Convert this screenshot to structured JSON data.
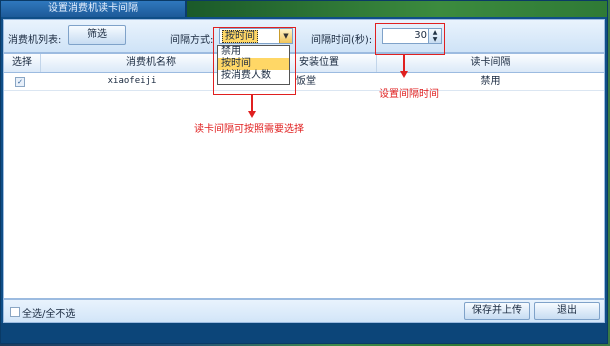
{
  "window": {
    "title": "设置消费机读卡间隔"
  },
  "toolbar": {
    "machine_list_label": "消费机列表:",
    "filter_button": "筛选",
    "interval_mode_label": "间隔方式:",
    "interval_mode_value": "按时间",
    "interval_time_label": "间隔时间(秒):",
    "interval_time_value": "30"
  },
  "dropdown": {
    "options": [
      "禁用",
      "按时间",
      "按消费人数"
    ],
    "selected": "按时间"
  },
  "table": {
    "headers": [
      "选择",
      "消费机名称",
      "安装位置",
      "读卡间隔"
    ],
    "rows": [
      {
        "checked": true,
        "name": "xiaofeiji",
        "location": "饭堂",
        "interval": "禁用"
      }
    ]
  },
  "annotations": {
    "dropdown_note": "读卡间隔可按照需要选择",
    "spinner_note": "设置间隔时间",
    "color": "#e02020"
  },
  "footer": {
    "select_all_label": "全选/全不选",
    "save_button": "保存并上传",
    "exit_button": "退出"
  }
}
